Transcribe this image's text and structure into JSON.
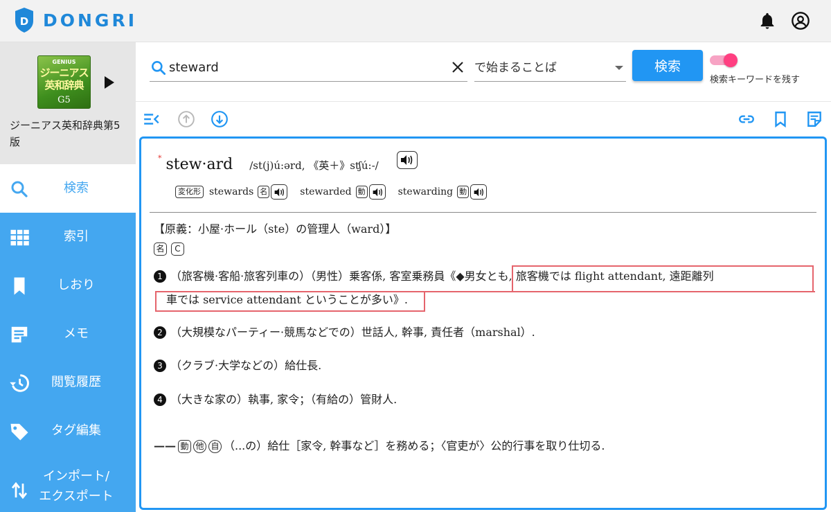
{
  "header": {
    "brand": "DONGRI",
    "icons": [
      "bell-icon",
      "account-icon"
    ]
  },
  "sidebar": {
    "book": {
      "cover_brand": "GENIUS",
      "cover_title": "ジーニアス英和辞典",
      "cover_edition": "G5",
      "title": "ジーニアス英和辞典第5版"
    },
    "items": [
      {
        "label": "検索",
        "icon": "search-icon"
      },
      {
        "label": "索引",
        "icon": "grid-icon"
      },
      {
        "label": "しおり",
        "icon": "bookmark-icon"
      },
      {
        "label": "メモ",
        "icon": "note-icon"
      },
      {
        "label": "閲覧履歴",
        "icon": "history-icon"
      },
      {
        "label": "タグ編集",
        "icon": "tag-icon"
      },
      {
        "label_line1": "インポート/",
        "label_line2": "エクスポート",
        "icon": "import-export-icon"
      }
    ]
  },
  "search": {
    "query": "steward",
    "mode": "で始まることば",
    "button": "検索",
    "keep_keyword_label": "検索キーワードを残す",
    "keep_keyword_on": true
  },
  "colors": {
    "accent": "#2196f3",
    "sidebar": "#44a7f0",
    "highlight": "#e5646c",
    "toggle": "#ff3f81"
  },
  "entry": {
    "star": "*",
    "headword": "stew·ard",
    "pronunciation": "/st(j)ú:ərd, 《英＋》sʧú:-/",
    "inflection_label": "変化形",
    "inflections": [
      {
        "form": "stewards",
        "pos": "名"
      },
      {
        "form": "stewarded",
        "pos": "動"
      },
      {
        "form": "stewarding",
        "pos": "動"
      }
    ],
    "etymology": "【原義：小屋·ホール（ste）の管理人（ward）】",
    "pos_noun": "名",
    "pos_countable": "C",
    "senses": [
      {
        "num": "1",
        "text_before": "（旅客機·客船·旅客列車の）（男性）乗客係, 客室乗務員",
        "note_line1": "《◆男女とも, 旅客機では flight attendant, 遠距離列",
        "note_line2": "車では service attendant ということが多い》",
        "end": "."
      },
      {
        "num": "2",
        "text": "（大規模なパーティー·競馬などでの）世話人, 幹事, 責任者（marshal）."
      },
      {
        "num": "3",
        "text": "（クラブ·大学などの）給仕長."
      },
      {
        "num": "4",
        "text": "（大きな家の）執事, 家令；（有給の）管財人."
      }
    ],
    "verb": {
      "dash": "——",
      "pos1": "動",
      "pos2": "他",
      "pos3": "自",
      "text": "（...の）給仕［家令, 幹事など］を務める；〈官吏が〉公的行事を取り仕切る."
    }
  }
}
